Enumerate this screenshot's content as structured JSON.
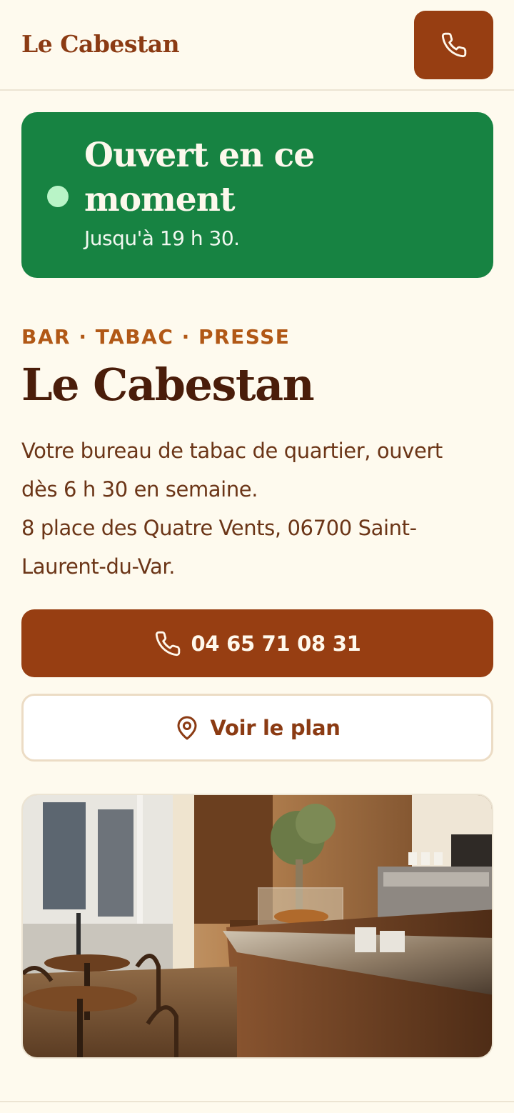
{
  "header": {
    "brand": "Le Cabestan",
    "call_icon": "phone-icon"
  },
  "status": {
    "title": "Ouvert en ce moment",
    "subtitle": "Jusqu'à 19 h 30.",
    "color": "#178342"
  },
  "intro": {
    "eyebrow": "BAR · TABAC · PRESSE",
    "title": "Le Cabestan",
    "description_1": "Votre bureau de tabac de quartier, ouvert dès 6 h 30 en semaine.",
    "description_2": "8 place des Quatre Vents, 06700 Saint-Laurent-du-Var."
  },
  "actions": {
    "phone_label": "04 65 71 08 31",
    "phone_icon": "phone-icon",
    "map_label": "Voir le plan",
    "map_icon": "map-pin-icon"
  },
  "colors": {
    "accent": "#973e12",
    "background": "#fefaee",
    "open_green": "#178342"
  }
}
